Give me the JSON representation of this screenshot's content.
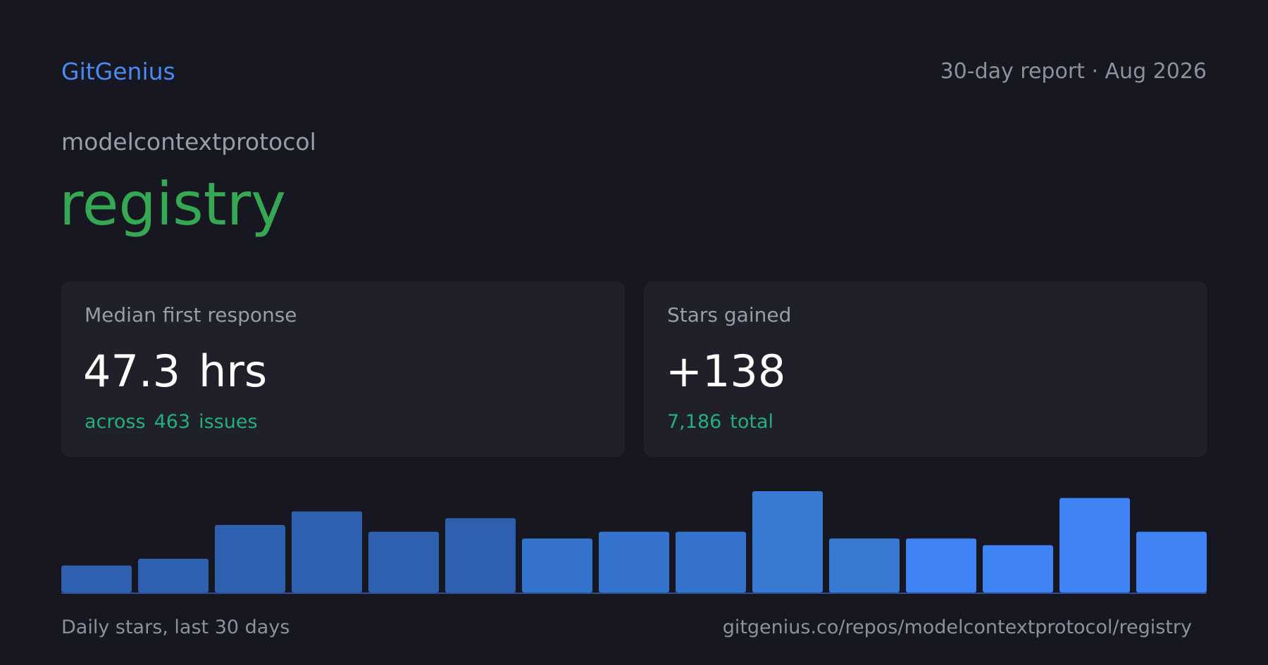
{
  "header": {
    "brand": "GitGenius",
    "report": "30-day report · Aug 2026"
  },
  "repo": {
    "owner": "modelcontextprotocol",
    "name": "registry"
  },
  "cards": {
    "response": {
      "label": "Median first response",
      "value": "47.3",
      "unit": "hrs",
      "sub_prefix": "across",
      "sub_count": "463",
      "sub_suffix": "issues"
    },
    "stars": {
      "label": "Stars gained",
      "value": "+138",
      "sub_count": "7,186",
      "sub_suffix": "total"
    }
  },
  "chart_data": {
    "type": "bar",
    "values": [
      4,
      5,
      10,
      12,
      9,
      11,
      8,
      9,
      9,
      15,
      8,
      8,
      7,
      14,
      9
    ],
    "colors": [
      "#2f5faf",
      "#2f5faf",
      "#2f5faf",
      "#2f5faf",
      "#2f5faf",
      "#2f5faf",
      "#3474cc",
      "#3474cc",
      "#3474cc",
      "#3779d3",
      "#3779d3",
      "#3f83f5",
      "#3f83f5",
      "#3f83f5",
      "#3f83f5"
    ],
    "ylim": [
      0,
      15
    ],
    "grid": false,
    "legend": "none"
  },
  "footer": {
    "caption": "Daily stars, last 30 days",
    "url": "gitgenius.co/repos/modelcontextprotocol/registry"
  }
}
